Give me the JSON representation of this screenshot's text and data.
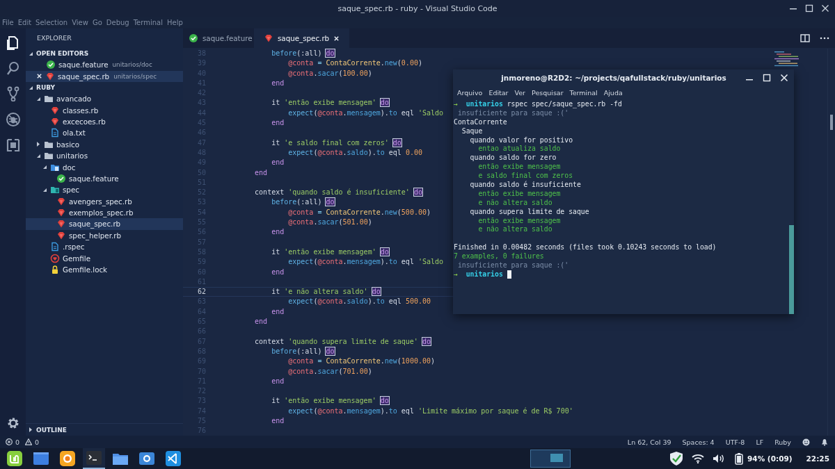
{
  "window": {
    "title": "saque_spec.rb - ruby - Visual Studio Code"
  },
  "menu": [
    "File",
    "Edit",
    "Selection",
    "View",
    "Go",
    "Debug",
    "Terminal",
    "Help"
  ],
  "activity_bar": [
    {
      "kind": "files",
      "selected": true
    },
    {
      "kind": "search",
      "selected": false
    },
    {
      "kind": "branch",
      "selected": false
    },
    {
      "kind": "debug",
      "selected": false
    },
    {
      "kind": "extensions",
      "selected": false
    }
  ],
  "sidebar": {
    "title": "EXPLORER",
    "open_editors": {
      "label": "OPEN EDITORS",
      "expanded": true,
      "items": [
        {
          "label": "saque.feature",
          "description": "unitarios/doc",
          "kind": "cucumber",
          "selected": false
        },
        {
          "label": "saque_spec.rb",
          "description": "unitarios/spec",
          "kind": "ruby",
          "selected": true
        }
      ]
    },
    "folder": {
      "label": "RUBY",
      "expanded": true,
      "items": [
        {
          "label": "avancado",
          "kind": "folder",
          "expanded": true,
          "selected": false,
          "children": [
            {
              "label": "classes.rb",
              "kind": "ruby",
              "selected": false
            },
            {
              "label": "excecoes.rb",
              "kind": "ruby",
              "selected": false
            },
            {
              "label": "ola.txt",
              "kind": "text",
              "selected": false
            }
          ]
        },
        {
          "label": "basico",
          "kind": "folder",
          "expanded": false,
          "selected": false
        },
        {
          "label": "unitarios",
          "kind": "folder",
          "expanded": true,
          "selected": false,
          "children": [
            {
              "label": "doc",
              "kind": "folder-doc",
              "expanded": true,
              "selected": false,
              "children": [
                {
                  "label": "saque.feature",
                  "kind": "cucumber",
                  "selected": false
                }
              ]
            },
            {
              "label": "spec",
              "kind": "folder-spec",
              "expanded": true,
              "selected": false,
              "children": [
                {
                  "label": "avengers_spec.rb",
                  "kind": "ruby",
                  "selected": false
                },
                {
                  "label": "exemplos_spec.rb",
                  "kind": "ruby",
                  "selected": false
                },
                {
                  "label": "saque_spec.rb",
                  "kind": "ruby",
                  "selected": true
                },
                {
                  "label": "spec_helper.rb",
                  "kind": "ruby",
                  "selected": false
                }
              ]
            },
            {
              "label": ".rspec",
              "kind": "text",
              "selected": false
            },
            {
              "label": "Gemfile",
              "kind": "gemfile",
              "selected": false
            },
            {
              "label": "Gemfile.lock",
              "kind": "lock",
              "selected": false
            }
          ]
        }
      ]
    },
    "outline": {
      "label": "OUTLINE",
      "expanded": false
    }
  },
  "tabs": [
    {
      "label": "saque.feature",
      "kind": "cucumber",
      "selected": false
    },
    {
      "label": "saque_spec.rb",
      "kind": "ruby",
      "selected": true
    }
  ],
  "editor": {
    "lines": [
      {
        "number": "38",
        "current": false,
        "tokens": [
          {
            "kind": "kw",
            "text": "        before"
          },
          {
            "kind": "plain",
            "text": "(:all) "
          },
          {
            "kind": "match",
            "text": "do"
          }
        ]
      },
      {
        "number": "39",
        "current": false,
        "tokens": [
          {
            "kind": "ivar",
            "text": "            @conta"
          },
          {
            "kind": "op",
            "text": " = "
          },
          {
            "kind": "cls",
            "text": "ContaCorrente"
          },
          {
            "kind": "plain",
            "text": "."
          },
          {
            "kind": "method",
            "text": "new"
          },
          {
            "kind": "plain",
            "text": "("
          },
          {
            "kind": "num",
            "text": "0.00"
          },
          {
            "kind": "plain",
            "text": ")"
          }
        ]
      },
      {
        "number": "40",
        "current": false,
        "tokens": [
          {
            "kind": "ivar",
            "text": "            @conta"
          },
          {
            "kind": "plain",
            "text": "."
          },
          {
            "kind": "method",
            "text": "sacar"
          },
          {
            "kind": "plain",
            "text": "("
          },
          {
            "kind": "num",
            "text": "100.00"
          },
          {
            "kind": "plain",
            "text": ")"
          }
        ]
      },
      {
        "number": "41",
        "current": false,
        "tokens": [
          {
            "kind": "end",
            "text": "        end"
          }
        ]
      },
      {
        "number": "42",
        "current": false
      },
      {
        "number": "43",
        "current": false,
        "tokens": [
          {
            "kind": "plain",
            "text": "        it "
          },
          {
            "kind": "str",
            "text": "'então exibe mensagem' "
          },
          {
            "kind": "match",
            "text": "do"
          }
        ]
      },
      {
        "number": "44",
        "current": false,
        "tokens": [
          {
            "kind": "kw",
            "text": "            expect"
          },
          {
            "kind": "plain",
            "text": "("
          },
          {
            "kind": "ivar",
            "text": "@conta"
          },
          {
            "kind": "plain",
            "text": "."
          },
          {
            "kind": "method",
            "text": "mensagem"
          },
          {
            "kind": "plain",
            "text": ")."
          },
          {
            "kind": "method",
            "text": "to"
          },
          {
            "kind": "plain",
            "text": " eql "
          },
          {
            "kind": "str",
            "text": "'Saldo"
          }
        ]
      },
      {
        "number": "45",
        "current": false,
        "tokens": [
          {
            "kind": "end",
            "text": "        end"
          }
        ]
      },
      {
        "number": "46",
        "current": false
      },
      {
        "number": "47",
        "current": false,
        "tokens": [
          {
            "kind": "plain",
            "text": "        it "
          },
          {
            "kind": "str",
            "text": "'e saldo final com zeros' "
          },
          {
            "kind": "match",
            "text": "do"
          }
        ]
      },
      {
        "number": "48",
        "current": false,
        "tokens": [
          {
            "kind": "kw",
            "text": "            expect"
          },
          {
            "kind": "plain",
            "text": "("
          },
          {
            "kind": "ivar",
            "text": "@conta"
          },
          {
            "kind": "plain",
            "text": "."
          },
          {
            "kind": "method",
            "text": "saldo"
          },
          {
            "kind": "plain",
            "text": ")."
          },
          {
            "kind": "method",
            "text": "to"
          },
          {
            "kind": "plain",
            "text": " eql "
          },
          {
            "kind": "num",
            "text": "0.00"
          }
        ]
      },
      {
        "number": "49",
        "current": false,
        "tokens": [
          {
            "kind": "end",
            "text": "        end"
          }
        ]
      },
      {
        "number": "50",
        "current": false,
        "tokens": [
          {
            "kind": "end",
            "text": "    end"
          }
        ]
      },
      {
        "number": "51",
        "current": false
      },
      {
        "number": "52",
        "current": false,
        "tokens": [
          {
            "kind": "plain",
            "text": "    context "
          },
          {
            "kind": "str",
            "text": "'quando saldo é insuficiente' "
          },
          {
            "kind": "match",
            "text": "do"
          }
        ]
      },
      {
        "number": "53",
        "current": false,
        "tokens": [
          {
            "kind": "kw",
            "text": "        before"
          },
          {
            "kind": "plain",
            "text": "(:all) "
          },
          {
            "kind": "match",
            "text": "do"
          }
        ]
      },
      {
        "number": "54",
        "current": false,
        "tokens": [
          {
            "kind": "ivar",
            "text": "            @conta"
          },
          {
            "kind": "op",
            "text": " = "
          },
          {
            "kind": "cls",
            "text": "ContaCorrente"
          },
          {
            "kind": "plain",
            "text": "."
          },
          {
            "kind": "method",
            "text": "new"
          },
          {
            "kind": "plain",
            "text": "("
          },
          {
            "kind": "num",
            "text": "500.00"
          },
          {
            "kind": "plain",
            "text": ")"
          }
        ]
      },
      {
        "number": "55",
        "current": false,
        "tokens": [
          {
            "kind": "ivar",
            "text": "            @conta"
          },
          {
            "kind": "plain",
            "text": "."
          },
          {
            "kind": "method",
            "text": "sacar"
          },
          {
            "kind": "plain",
            "text": "("
          },
          {
            "kind": "num",
            "text": "501.00"
          },
          {
            "kind": "plain",
            "text": ")"
          }
        ]
      },
      {
        "number": "56",
        "current": false,
        "tokens": [
          {
            "kind": "end",
            "text": "        end"
          }
        ]
      },
      {
        "number": "57",
        "current": false
      },
      {
        "number": "58",
        "current": false,
        "tokens": [
          {
            "kind": "plain",
            "text": "        it "
          },
          {
            "kind": "str",
            "text": "'então exibe mensagem' "
          },
          {
            "kind": "match",
            "text": "do"
          }
        ]
      },
      {
        "number": "59",
        "current": false,
        "tokens": [
          {
            "kind": "kw",
            "text": "            expect"
          },
          {
            "kind": "plain",
            "text": "("
          },
          {
            "kind": "ivar",
            "text": "@conta"
          },
          {
            "kind": "plain",
            "text": "."
          },
          {
            "kind": "method",
            "text": "mensagem"
          },
          {
            "kind": "plain",
            "text": ")."
          },
          {
            "kind": "method",
            "text": "to"
          },
          {
            "kind": "plain",
            "text": " eql "
          },
          {
            "kind": "str",
            "text": "'Saldo"
          }
        ]
      },
      {
        "number": "60",
        "current": false,
        "tokens": [
          {
            "kind": "end",
            "text": "        end"
          }
        ]
      },
      {
        "number": "61",
        "current": false
      },
      {
        "number": "62",
        "current": true,
        "tokens": [
          {
            "kind": "plain",
            "text": "        it "
          },
          {
            "kind": "str",
            "text": "'e não altera saldo' "
          },
          {
            "kind": "match",
            "text": "do"
          }
        ]
      },
      {
        "number": "63",
        "current": false,
        "tokens": [
          {
            "kind": "kw",
            "text": "            expect"
          },
          {
            "kind": "plain",
            "text": "("
          },
          {
            "kind": "ivar",
            "text": "@conta"
          },
          {
            "kind": "plain",
            "text": "."
          },
          {
            "kind": "method",
            "text": "saldo"
          },
          {
            "kind": "plain",
            "text": ")."
          },
          {
            "kind": "method",
            "text": "to"
          },
          {
            "kind": "plain",
            "text": " eql "
          },
          {
            "kind": "num",
            "text": "500.00"
          }
        ]
      },
      {
        "number": "64",
        "current": false,
        "tokens": [
          {
            "kind": "end",
            "text": "        end"
          }
        ]
      },
      {
        "number": "65",
        "current": false,
        "tokens": [
          {
            "kind": "end",
            "text": "    end"
          }
        ]
      },
      {
        "number": "66",
        "current": false
      },
      {
        "number": "67",
        "current": false,
        "tokens": [
          {
            "kind": "plain",
            "text": "    context "
          },
          {
            "kind": "str",
            "text": "'quando supera limite de saque' "
          },
          {
            "kind": "match",
            "text": "do"
          }
        ]
      },
      {
        "number": "68",
        "current": false,
        "tokens": [
          {
            "kind": "kw",
            "text": "        before"
          },
          {
            "kind": "plain",
            "text": "(:all) "
          },
          {
            "kind": "match",
            "text": "do"
          }
        ]
      },
      {
        "number": "69",
        "current": false,
        "tokens": [
          {
            "kind": "ivar",
            "text": "            @conta"
          },
          {
            "kind": "op",
            "text": " = "
          },
          {
            "kind": "cls",
            "text": "ContaCorrente"
          },
          {
            "kind": "plain",
            "text": "."
          },
          {
            "kind": "method",
            "text": "new"
          },
          {
            "kind": "plain",
            "text": "("
          },
          {
            "kind": "num",
            "text": "1000.00"
          },
          {
            "kind": "plain",
            "text": ")"
          }
        ]
      },
      {
        "number": "70",
        "current": false,
        "tokens": [
          {
            "kind": "ivar",
            "text": "            @conta"
          },
          {
            "kind": "plain",
            "text": "."
          },
          {
            "kind": "method",
            "text": "sacar"
          },
          {
            "kind": "plain",
            "text": "("
          },
          {
            "kind": "num",
            "text": "701.00"
          },
          {
            "kind": "plain",
            "text": ")"
          }
        ]
      },
      {
        "number": "71",
        "current": false,
        "tokens": [
          {
            "kind": "end",
            "text": "        end"
          }
        ]
      },
      {
        "number": "72",
        "current": false
      },
      {
        "number": "73",
        "current": false,
        "tokens": [
          {
            "kind": "plain",
            "text": "        it "
          },
          {
            "kind": "str",
            "text": "'então exibe mensagem' "
          },
          {
            "kind": "match",
            "text": "do"
          }
        ]
      },
      {
        "number": "74",
        "current": false,
        "tokens": [
          {
            "kind": "kw",
            "text": "            expect"
          },
          {
            "kind": "plain",
            "text": "("
          },
          {
            "kind": "ivar",
            "text": "@conta"
          },
          {
            "kind": "plain",
            "text": "."
          },
          {
            "kind": "method",
            "text": "mensagem"
          },
          {
            "kind": "plain",
            "text": ")."
          },
          {
            "kind": "method",
            "text": "to"
          },
          {
            "kind": "plain",
            "text": " eql "
          },
          {
            "kind": "str",
            "text": "'Limite máximo por saque é de R$ 700'"
          }
        ]
      },
      {
        "number": "75",
        "current": false,
        "tokens": [
          {
            "kind": "end",
            "text": "        end"
          }
        ]
      },
      {
        "number": "76",
        "current": false
      }
    ]
  },
  "terminal": {
    "title": "jnmoreno@R2D2: ~/projects/qafullstack/ruby/unitarios",
    "menu": [
      "Arquivo",
      "Editar",
      "Ver",
      "Pesquisar",
      "Terminal",
      "Ajuda"
    ],
    "lines": [
      {
        "kind": "text",
        "segments": [
          {
            "kind": "arrow",
            "text": "→ "
          },
          {
            "kind": "dir",
            "text": " unitarios"
          },
          {
            "kind": "plain",
            "text": " rspec spec/saque_spec.rb -fd"
          }
        ]
      },
      {
        "kind": "text",
        "segments": [
          {
            "kind": "ghost",
            "text": " insuficiente para saque :('"
          }
        ]
      },
      {
        "kind": "text",
        "segments": [
          {
            "kind": "plain",
            "text": "ContaCorrente"
          }
        ]
      },
      {
        "kind": "text",
        "segments": [
          {
            "kind": "plain",
            "text": "  Saque"
          }
        ]
      },
      {
        "kind": "text",
        "segments": [
          {
            "kind": "plain",
            "text": "    quando valor for positivo"
          }
        ]
      },
      {
        "kind": "text",
        "segments": [
          {
            "kind": "pass",
            "text": "      entao atualiza saldo"
          }
        ]
      },
      {
        "kind": "text",
        "segments": [
          {
            "kind": "plain",
            "text": "    quando saldo for zero"
          }
        ]
      },
      {
        "kind": "text",
        "segments": [
          {
            "kind": "pass",
            "text": "      então exibe mensagem"
          }
        ]
      },
      {
        "kind": "text",
        "segments": [
          {
            "kind": "pass",
            "text": "      e saldo final com zeros"
          }
        ]
      },
      {
        "kind": "text",
        "segments": [
          {
            "kind": "plain",
            "text": "    quando saldo é insuficiente"
          }
        ]
      },
      {
        "kind": "text",
        "segments": [
          {
            "kind": "pass",
            "text": "      então exibe mensagem"
          }
        ]
      },
      {
        "kind": "text",
        "segments": [
          {
            "kind": "pass",
            "text": "      e não altera saldo"
          }
        ]
      },
      {
        "kind": "text",
        "segments": [
          {
            "kind": "plain",
            "text": "    quando supera limite de saque"
          }
        ]
      },
      {
        "kind": "text",
        "segments": [
          {
            "kind": "pass",
            "text": "      então exibe mensagem"
          }
        ]
      },
      {
        "kind": "text",
        "segments": [
          {
            "kind": "pass",
            "text": "      e não altera saldo"
          }
        ]
      },
      {
        "kind": "blank"
      },
      {
        "kind": "text",
        "segments": [
          {
            "kind": "plain",
            "text": "Finished in 0.00482 seconds (files took 0.10243 seconds to load)"
          }
        ]
      },
      {
        "kind": "text",
        "segments": [
          {
            "kind": "pass",
            "text": "7 examples, 0 failures"
          }
        ]
      },
      {
        "kind": "text",
        "segments": [
          {
            "kind": "ghost",
            "text": " insuficiente para saque :('"
          }
        ]
      },
      {
        "kind": "text",
        "cursor": true,
        "segments": [
          {
            "kind": "arrow",
            "text": "→ "
          },
          {
            "kind": "dir",
            "text": " unitarios "
          }
        ]
      }
    ]
  },
  "status_bar": {
    "problems": [
      {
        "kind": "error",
        "count": "0"
      },
      {
        "kind": "warning",
        "count": "0"
      }
    ],
    "items": [
      "Ln 62, Col 39",
      "Spaces: 4",
      "UTF-8",
      "LF",
      "Ruby"
    ]
  },
  "taskbar": {
    "apps": [
      {
        "kind": "menu",
        "active": false
      },
      {
        "kind": "window",
        "active": false
      },
      {
        "kind": "browser",
        "active": false
      },
      {
        "kind": "terminal",
        "active": true
      },
      {
        "kind": "folder",
        "active": false
      },
      {
        "kind": "camera",
        "active": false
      },
      {
        "kind": "editor",
        "active": false
      }
    ],
    "battery": "94% (0:09)",
    "clock": "22:25"
  }
}
